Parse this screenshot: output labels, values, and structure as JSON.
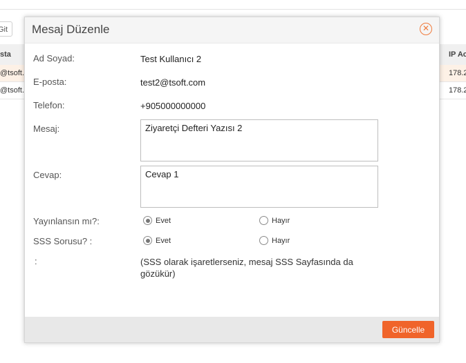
{
  "background": {
    "git_button": "Git",
    "table": {
      "headers": [
        "sta",
        "IP Ac"
      ],
      "rows": [
        {
          "email": "@tsoft.c",
          "ip": "178.2"
        },
        {
          "email": "@tsoft.c",
          "ip": "178.2"
        }
      ]
    }
  },
  "modal": {
    "title": "Mesaj Düzenle",
    "close_icon": "close-circle-icon",
    "fields": {
      "name_label": "Ad Soyad:",
      "name_value": "Test Kullanıcı 2",
      "email_label": "E-posta:",
      "email_value": "test2@tsoft.com",
      "phone_label": "Telefon:",
      "phone_value": "+905000000000",
      "message_label": "Mesaj:",
      "message_value": "Ziyaretçi Defteri Yazısı 2",
      "reply_label": "Cevap:",
      "reply_value": "Cevap 1"
    },
    "publish": {
      "label": "Yayınlansın mı?:",
      "yes": "Evet",
      "no": "Hayır",
      "selected": "Evet"
    },
    "faq": {
      "label": "SSS Sorusu? :",
      "yes": "Evet",
      "no": "Hayır",
      "selected": "Evet"
    },
    "note_label": ":",
    "note": "(SSS olarak işaretlerseniz, mesaj SSS Sayfasında da gözükür)",
    "update_button": "Güncelle"
  },
  "colors": {
    "accent": "#f0642a",
    "highlight_row": "#fdf1e6"
  }
}
